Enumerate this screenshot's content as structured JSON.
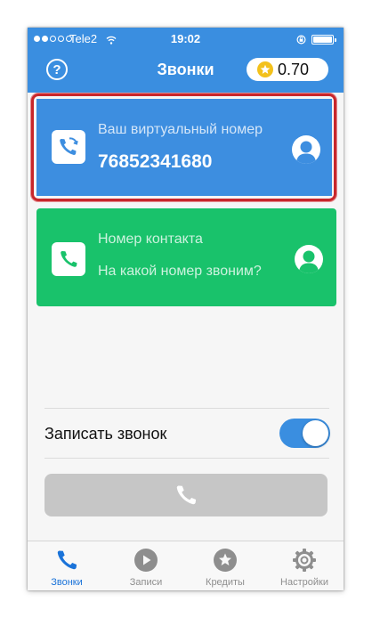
{
  "status_bar": {
    "carrier": "Tele2",
    "time": "19:02"
  },
  "nav": {
    "title": "Звонки",
    "help_label": "?",
    "credits": "0.70"
  },
  "virtual_number_card": {
    "label": "Ваш виртуальный номер",
    "number": "76852341680"
  },
  "contact_card": {
    "label": "Номер контакта",
    "hint": "На какой номер звоним?"
  },
  "record": {
    "label": "Записать звонок",
    "enabled": true
  },
  "tabs": [
    {
      "label": "Звонки",
      "icon": "phone-icon",
      "active": true
    },
    {
      "label": "Записи",
      "icon": "play-icon",
      "active": false
    },
    {
      "label": "Кредиты",
      "icon": "star-icon",
      "active": false
    },
    {
      "label": "Настройки",
      "icon": "gear-icon",
      "active": false
    }
  ],
  "colors": {
    "primary": "#3a8ee0",
    "contact_green": "#19c26b",
    "highlight_red": "#c8262b",
    "disabled_gray": "#c6c6c6"
  }
}
